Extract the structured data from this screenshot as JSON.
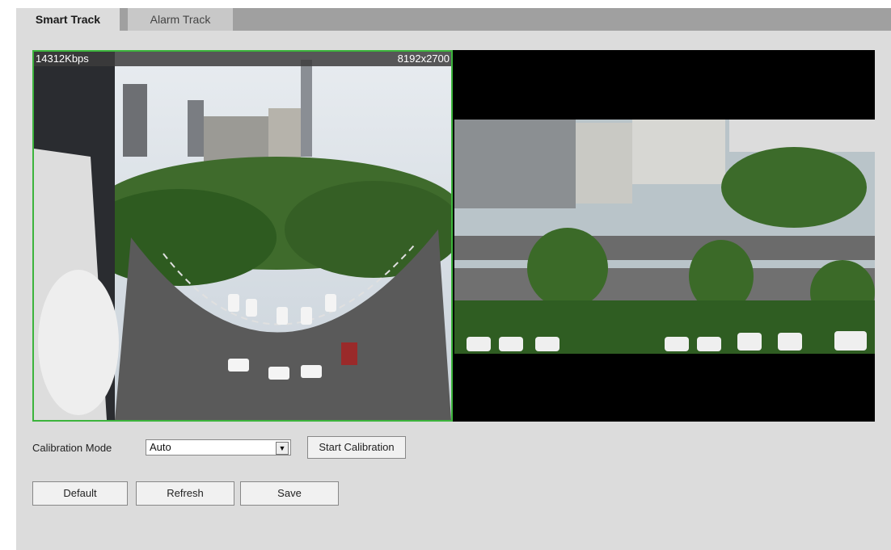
{
  "tabs": [
    {
      "label": "Smart Track",
      "active": true
    },
    {
      "label": "Alarm Track",
      "active": false
    }
  ],
  "video": {
    "bitrate": "14312Kbps",
    "resolution": "8192x2700"
  },
  "calibration": {
    "label": "Calibration Mode",
    "selected": "Auto",
    "start_button": "Start Calibration"
  },
  "buttons": {
    "default": "Default",
    "refresh": "Refresh",
    "save": "Save"
  }
}
